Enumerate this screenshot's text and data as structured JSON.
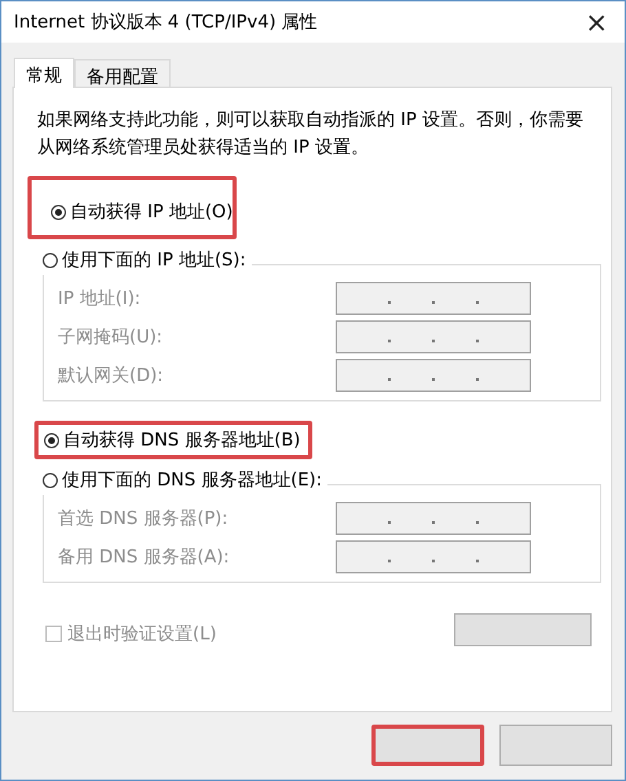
{
  "window": {
    "title": "Internet 协议版本 4 (TCP/IPv4) 属性",
    "close": "×"
  },
  "tabs": [
    {
      "label": "常规",
      "selected": true
    },
    {
      "label": "备用配置",
      "selected": false
    }
  ],
  "description": "如果网络支持此功能，则可以获取自动指派的 IP 设置。否则，你需要从网络系统管理员处获得适当的 IP 设置。",
  "ip_section": {
    "options": [
      {
        "label": "自动获得 IP 地址(O)",
        "selected": true,
        "highlighted": true
      },
      {
        "label": "使用下面的 IP 地址(S):",
        "selected": false,
        "highlighted": false
      }
    ],
    "fields": [
      {
        "label": "IP 地址(I):",
        "disabled": true
      },
      {
        "label": "子网掩码(U):",
        "disabled": true
      },
      {
        "label": "默认网关(D):",
        "disabled": true
      }
    ]
  },
  "dns_section": {
    "options": [
      {
        "label": "自动获得 DNS 服务器地址(B)",
        "selected": true,
        "highlighted": true
      },
      {
        "label": "使用下面的 DNS 服务器地址(E):",
        "selected": false,
        "highlighted": false
      }
    ],
    "fields": [
      {
        "label": "首选 DNS 服务器(P):",
        "disabled": true
      },
      {
        "label": "备用 DNS 服务器(A):",
        "disabled": true
      }
    ]
  },
  "validate_checkbox": {
    "label": "退出时验证设置(L)",
    "checked": false,
    "disabled": true
  },
  "buttons": [
    {
      "kind": "advanced",
      "highlighted": false
    },
    {
      "kind": "default",
      "highlighted": true
    },
    {
      "kind": "normal",
      "highlighted": false
    }
  ]
}
